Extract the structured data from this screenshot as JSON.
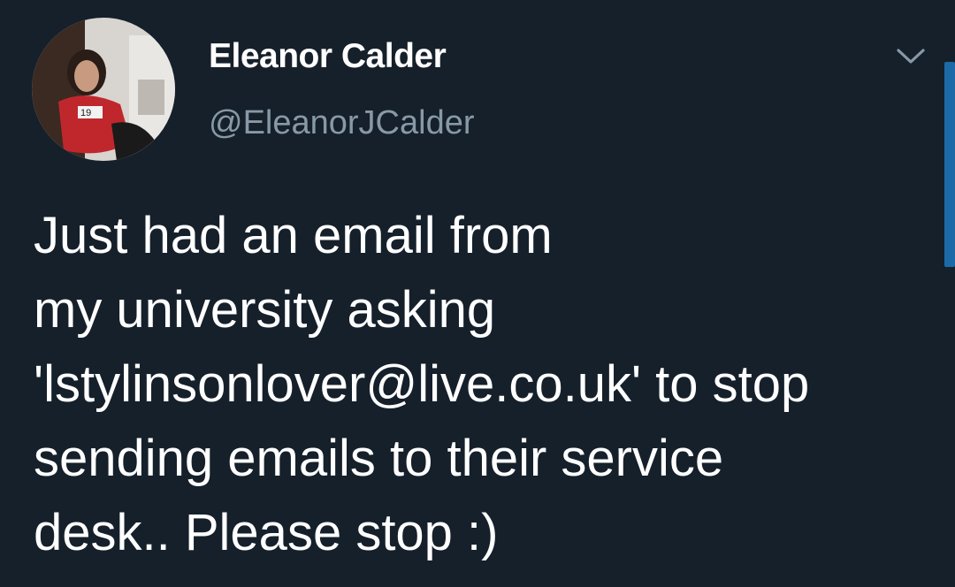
{
  "tweet": {
    "author": {
      "display_name": "Eleanor Calder",
      "handle": "@EleanorJCalder",
      "avatar_icon": "profile-photo"
    },
    "menu_icon": "chevron-down-icon",
    "text_lines": [
      "Just had an email from",
      "my university asking",
      "'lstylinsonlover@live.co.uk' to stop",
      "sending emails to their service",
      "desk.. Please stop :)"
    ]
  },
  "theme": {
    "background": "#15202b",
    "text": "#ffffff",
    "secondary_text": "#8899a6",
    "scrollbar": "#1c6aa8"
  }
}
